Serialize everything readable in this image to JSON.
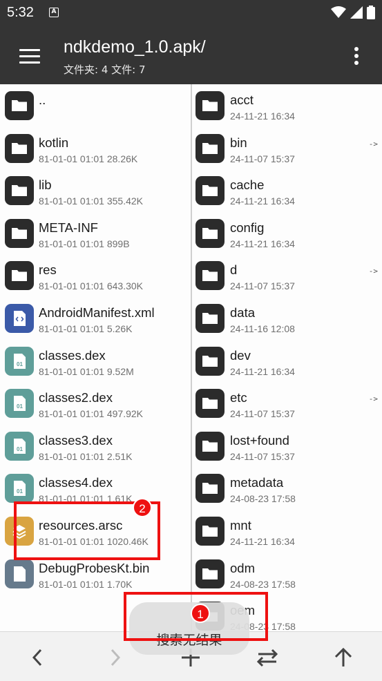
{
  "status_bar": {
    "time": "5:32",
    "notification_icon": "A"
  },
  "app_bar": {
    "title": "ndkdemo_1.0.apk/",
    "subtitle": "文件夹: 4  文件: 7"
  },
  "left_pane": {
    "items": [
      {
        "name": "..",
        "meta": "",
        "icon": "folder"
      },
      {
        "name": "kotlin",
        "meta": "81-01-01 01:01  28.26K",
        "icon": "folder"
      },
      {
        "name": "lib",
        "meta": "81-01-01 01:01  355.42K",
        "icon": "folder"
      },
      {
        "name": "META-INF",
        "meta": "81-01-01 01:01  899B",
        "icon": "folder"
      },
      {
        "name": "res",
        "meta": "81-01-01 01:01  643.30K",
        "icon": "folder"
      },
      {
        "name": "AndroidManifest.xml",
        "meta": "81-01-01 01:01  5.26K",
        "icon": "xml"
      },
      {
        "name": "classes.dex",
        "meta": "81-01-01 01:01  9.52M",
        "icon": "dex"
      },
      {
        "name": "classes2.dex",
        "meta": "81-01-01 01:01  497.92K",
        "icon": "dex"
      },
      {
        "name": "classes3.dex",
        "meta": "81-01-01 01:01  2.51K",
        "icon": "dex"
      },
      {
        "name": "classes4.dex",
        "meta": "81-01-01 01:01  1.61K",
        "icon": "dex"
      },
      {
        "name": "resources.arsc",
        "meta": "81-01-01 01:01  1020.46K",
        "icon": "arsc"
      },
      {
        "name": "DebugProbesKt.bin",
        "meta": "81-01-01 01:01  1.70K",
        "icon": "bin"
      }
    ]
  },
  "right_pane": {
    "items": [
      {
        "name": "acct",
        "meta": "24-11-21 16:34",
        "link": ""
      },
      {
        "name": "bin",
        "meta": "24-11-07 15:37",
        "link": "->"
      },
      {
        "name": "cache",
        "meta": "24-11-21 16:34",
        "link": ""
      },
      {
        "name": "config",
        "meta": "24-11-21 16:34",
        "link": ""
      },
      {
        "name": "d",
        "meta": "24-11-07 15:37",
        "link": "->"
      },
      {
        "name": "data",
        "meta": "24-11-16 12:08",
        "link": ""
      },
      {
        "name": "dev",
        "meta": "24-11-21 16:34",
        "link": ""
      },
      {
        "name": "etc",
        "meta": "24-11-07 15:37",
        "link": "->"
      },
      {
        "name": "lost+found",
        "meta": "24-11-07 15:37",
        "link": ""
      },
      {
        "name": "metadata",
        "meta": "24-08-23 17:58",
        "link": ""
      },
      {
        "name": "mnt",
        "meta": "24-11-21 16:34",
        "link": ""
      },
      {
        "name": "odm",
        "meta": "24-08-23 17:58",
        "link": ""
      },
      {
        "name": "oem",
        "meta": "24-08-23 17:58",
        "link": ""
      }
    ]
  },
  "toast": {
    "text": "搜索无结果"
  },
  "annotations": {
    "badge_1": "1",
    "badge_2": "2"
  },
  "bottom_bar": {
    "buttons": [
      "back-icon",
      "forward-icon",
      "add-icon",
      "swap-icon",
      "up-icon"
    ]
  },
  "colors": {
    "app_bar": "#343434",
    "folder_icon": "#2b2b2b",
    "xml_icon": "#3b5aa8",
    "dex_icon": "#5f9e99",
    "arsc_icon": "#d9a441",
    "bin_icon": "#667a8c",
    "annotation": "#ee1111"
  }
}
